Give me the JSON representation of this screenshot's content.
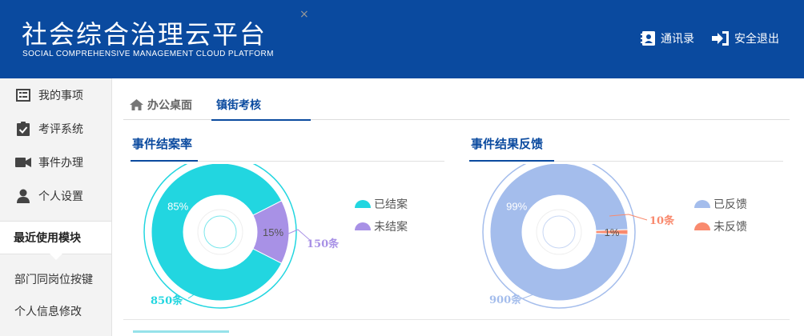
{
  "header": {
    "title": "社会综合治理云平台",
    "subtitle": "SOCIAL COMPREHENSIVE MANAGEMENT CLOUD PLATFORM",
    "contacts_label": "通讯录",
    "logout_label": "安全退出",
    "bg_color": "#0a4a9f"
  },
  "sidebar": {
    "items": [
      {
        "label": "我的事项",
        "icon": "list-icon"
      },
      {
        "label": "考评系统",
        "icon": "clipboard-check-icon"
      },
      {
        "label": "事件办理",
        "icon": "video-camera-icon"
      },
      {
        "label": "个人设置",
        "icon": "user-icon"
      }
    ],
    "recent_title": "最近使用模块",
    "recent_items": [
      {
        "label": "部门同岗位按键"
      },
      {
        "label": "个人信息修改"
      }
    ]
  },
  "tabs": {
    "home_label": "办公桌面",
    "active_label": "镇街考核",
    "close_glyph": "×"
  },
  "panels": {
    "left_title": "事件结案率",
    "right_title": "事件结果反馈"
  },
  "chart_data": [
    {
      "type": "pie",
      "title": "事件结案率",
      "categories": [
        "已结案",
        "未结案"
      ],
      "values": [
        850,
        150
      ],
      "percent_labels": [
        "85%",
        "15%"
      ],
      "count_labels": [
        "850条",
        "150条"
      ],
      "colors": [
        "#22d6e0",
        "#a891e6"
      ],
      "legend": "right"
    },
    {
      "type": "pie",
      "title": "事件结果反馈",
      "categories": [
        "已反馈",
        "未反馈"
      ],
      "values": [
        900,
        10
      ],
      "percent_labels": [
        "99%",
        "1%"
      ],
      "count_labels": [
        "900条",
        "10条"
      ],
      "colors": [
        "#a4bdec",
        "#f98a6e"
      ],
      "legend": "right"
    }
  ]
}
